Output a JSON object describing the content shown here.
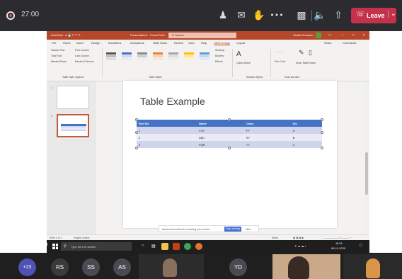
{
  "teams": {
    "timer": "27:00",
    "icons": [
      "participants-icon",
      "chat-icon",
      "raise-hand-icon",
      "more-icon",
      "camera-off-icon",
      "mute-icon",
      "share-tray-icon"
    ],
    "leave_label": "Leave"
  },
  "powerpoint": {
    "autosave": "AutoSave",
    "doc_title": "Presentation1 - PowerPoint",
    "search_placeholder": "Search",
    "user": "Sarika Chouhan",
    "ribbon_tabs": [
      "File",
      "Home",
      "Insert",
      "Design",
      "Transitions",
      "Animations",
      "Slide Show",
      "Review",
      "View",
      "Help",
      "Table Design",
      "Layout"
    ],
    "active_tab": "Table Design",
    "share_label": "Share",
    "comments_label": "Comments",
    "style_options": [
      "Header Row",
      "First Column",
      "Total Row",
      "Last Column",
      "Banded Rows",
      "Banded Columns"
    ],
    "groups": [
      "Table Style Options",
      "Table Styles",
      "WordArt Styles",
      "Draw Borders"
    ],
    "shading": "Shading",
    "borders": "Borders",
    "effects": "Effects",
    "quick_styles": "Quick Styles",
    "pen_color": "Pen Color",
    "draw_table": "Draw Table",
    "eraser": "Eraser",
    "slide_numbers": [
      "1",
      "2"
    ],
    "slide_title": "Table Example",
    "table": {
      "headers": [
        "Roll NO",
        "Name",
        "Class",
        "Div"
      ],
      "rows": [
        [
          "1",
          "XYZ",
          "FY",
          "A"
        ],
        [
          "2",
          "ABC",
          "SY",
          "B"
        ],
        [
          "3",
          "PQR",
          "TY",
          "C"
        ]
      ]
    },
    "status_slide": "Slide 2 of 2",
    "status_lang": "English (India)",
    "notes_label": "Notes",
    "zoom": "—"
  },
  "share_banner": {
    "text": "teams.microsoft.com is sharing your screen.",
    "stop": "Stop sharing",
    "hide": "Hide"
  },
  "taskbar": {
    "search_placeholder": "Type here to search",
    "time": "15:21",
    "date": "08-11-2020"
  },
  "presenter_name": "Sarika Chouhan",
  "participants": {
    "overflow": "+23",
    "initials": [
      "RS",
      "SS",
      "AS",
      "YD"
    ]
  }
}
